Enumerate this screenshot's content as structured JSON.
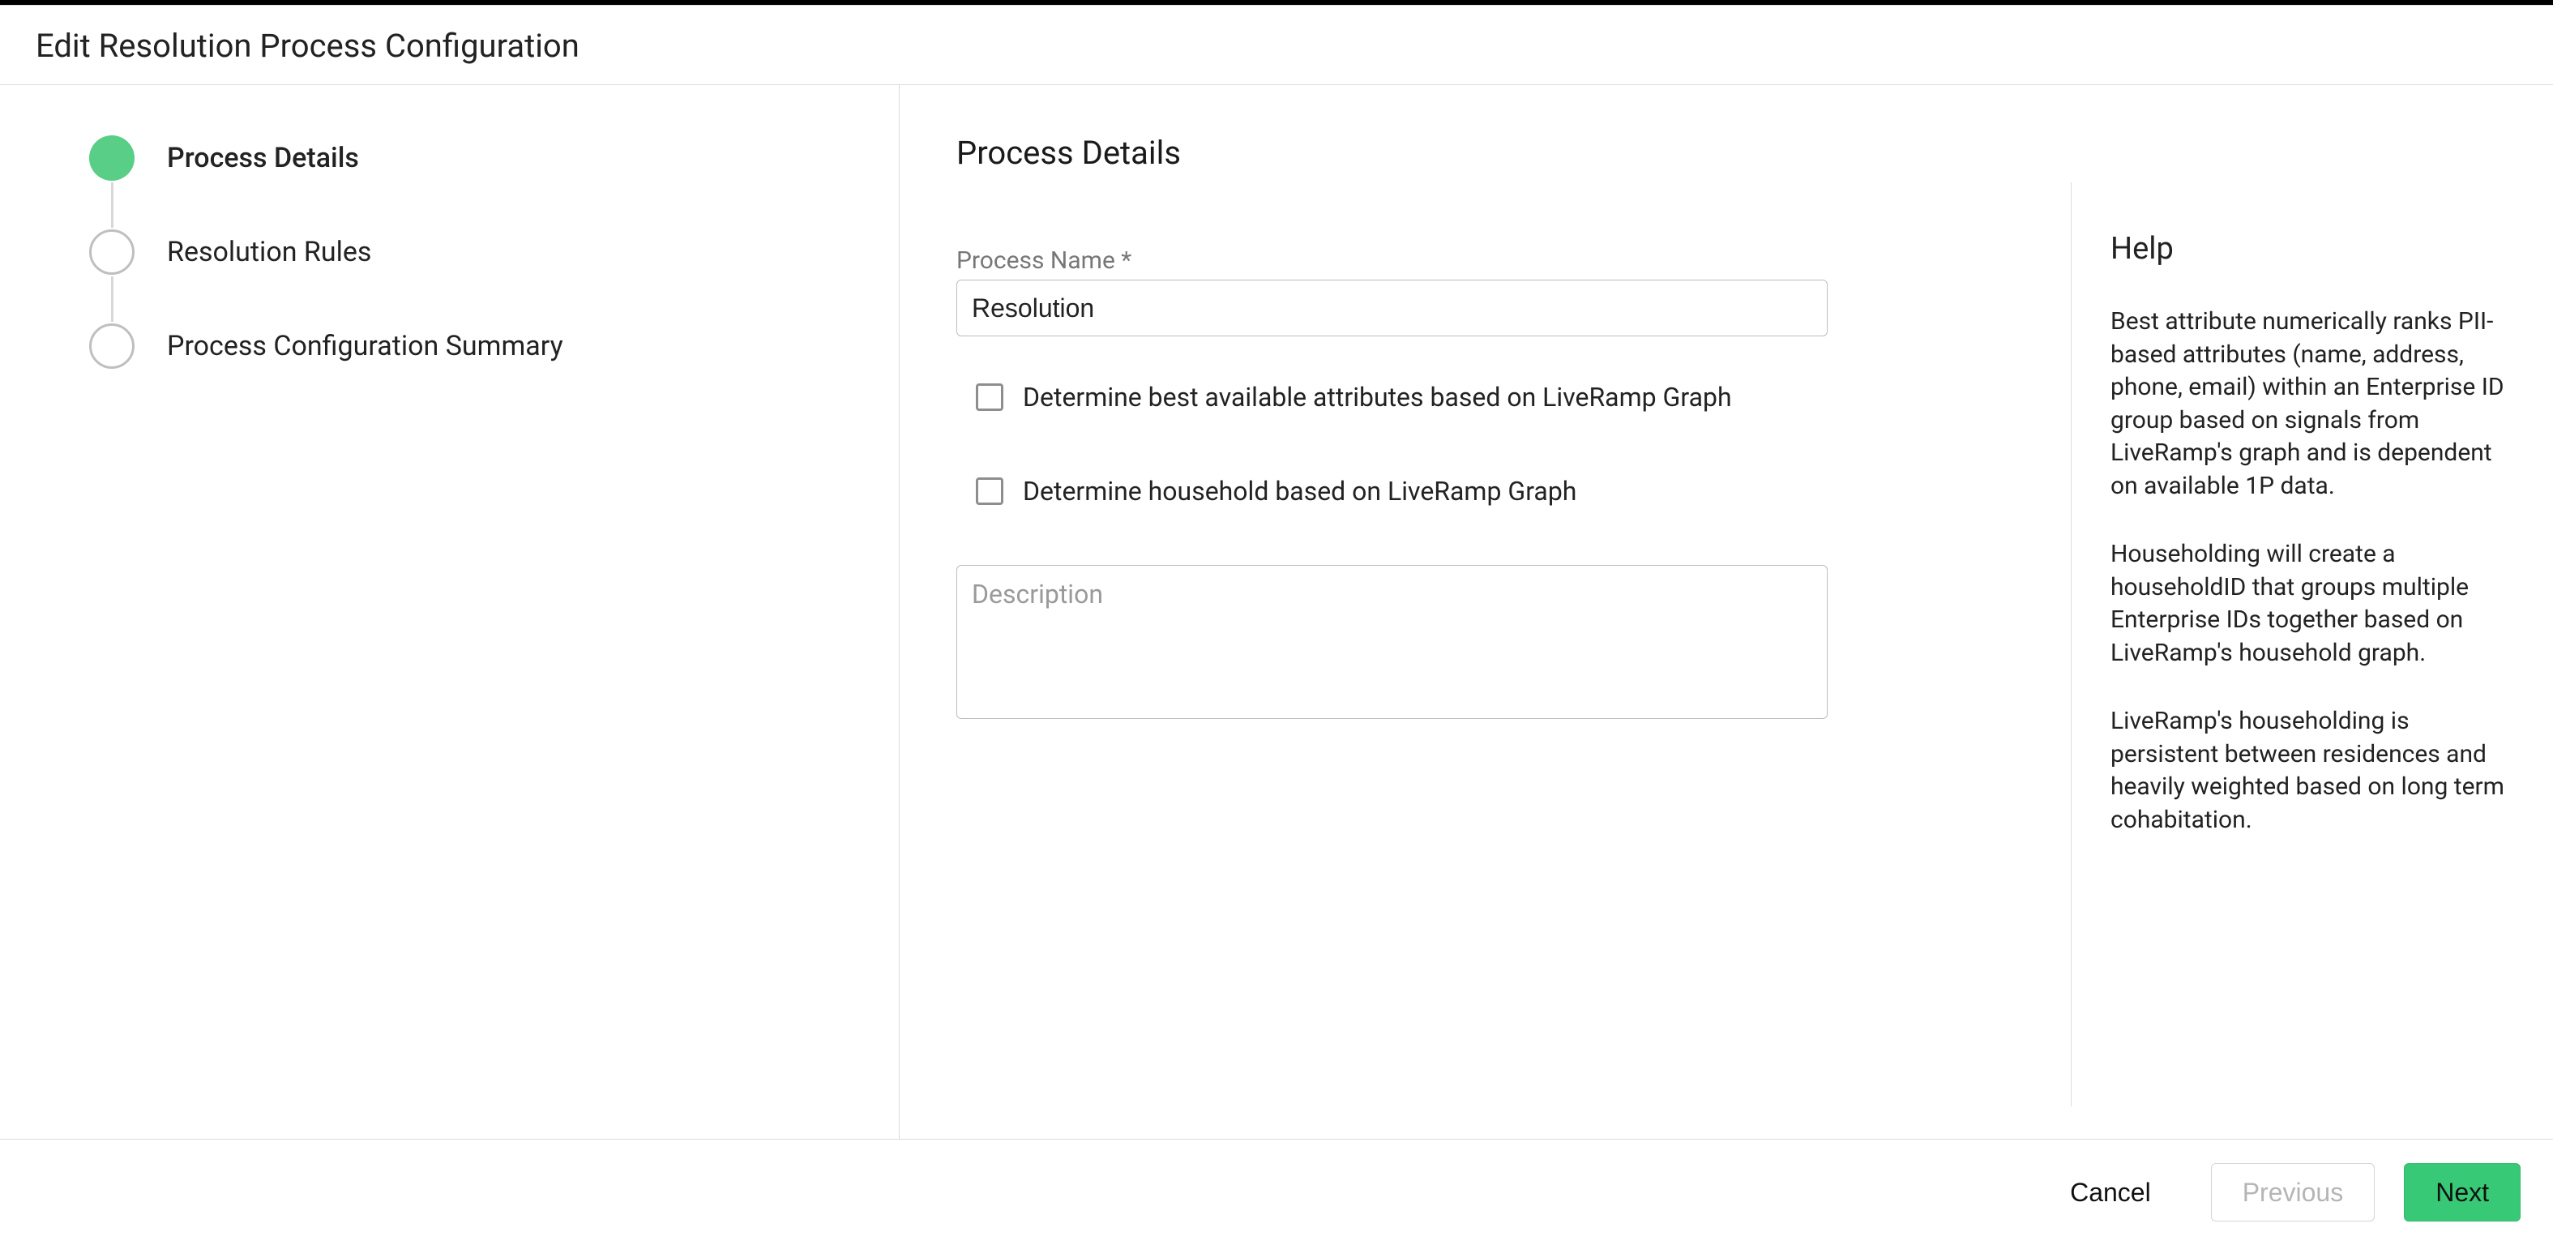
{
  "header": {
    "title": "Edit Resolution Process Configuration"
  },
  "stepper": {
    "steps": [
      {
        "label": "Process Details",
        "state": "active"
      },
      {
        "label": "Resolution Rules",
        "state": "inactive"
      },
      {
        "label": "Process Configuration Summary",
        "state": "inactive"
      }
    ]
  },
  "form": {
    "heading": "Process Details",
    "process_name_label": "Process Name *",
    "process_name_value": "Resolution",
    "cb_best_attr_label": "Determine best available attributes based on LiveRamp Graph",
    "cb_household_label": "Determine household based on LiveRamp Graph",
    "description_placeholder": "Description",
    "description_value": ""
  },
  "help": {
    "heading": "Help",
    "p1": "Best attribute numerically ranks PII-based attributes (name, address, phone, email) within an Enterprise ID group based on signals from LiveRamp's graph and is dependent on available 1P data.",
    "p2": "Householding will create a householdID that groups multiple Enterprise IDs together based on LiveRamp's household graph.",
    "p3": "LiveRamp's householding is persistent between residences and heavily weighted based on long term cohabitation."
  },
  "footer": {
    "cancel": "Cancel",
    "previous": "Previous",
    "next": "Next"
  }
}
